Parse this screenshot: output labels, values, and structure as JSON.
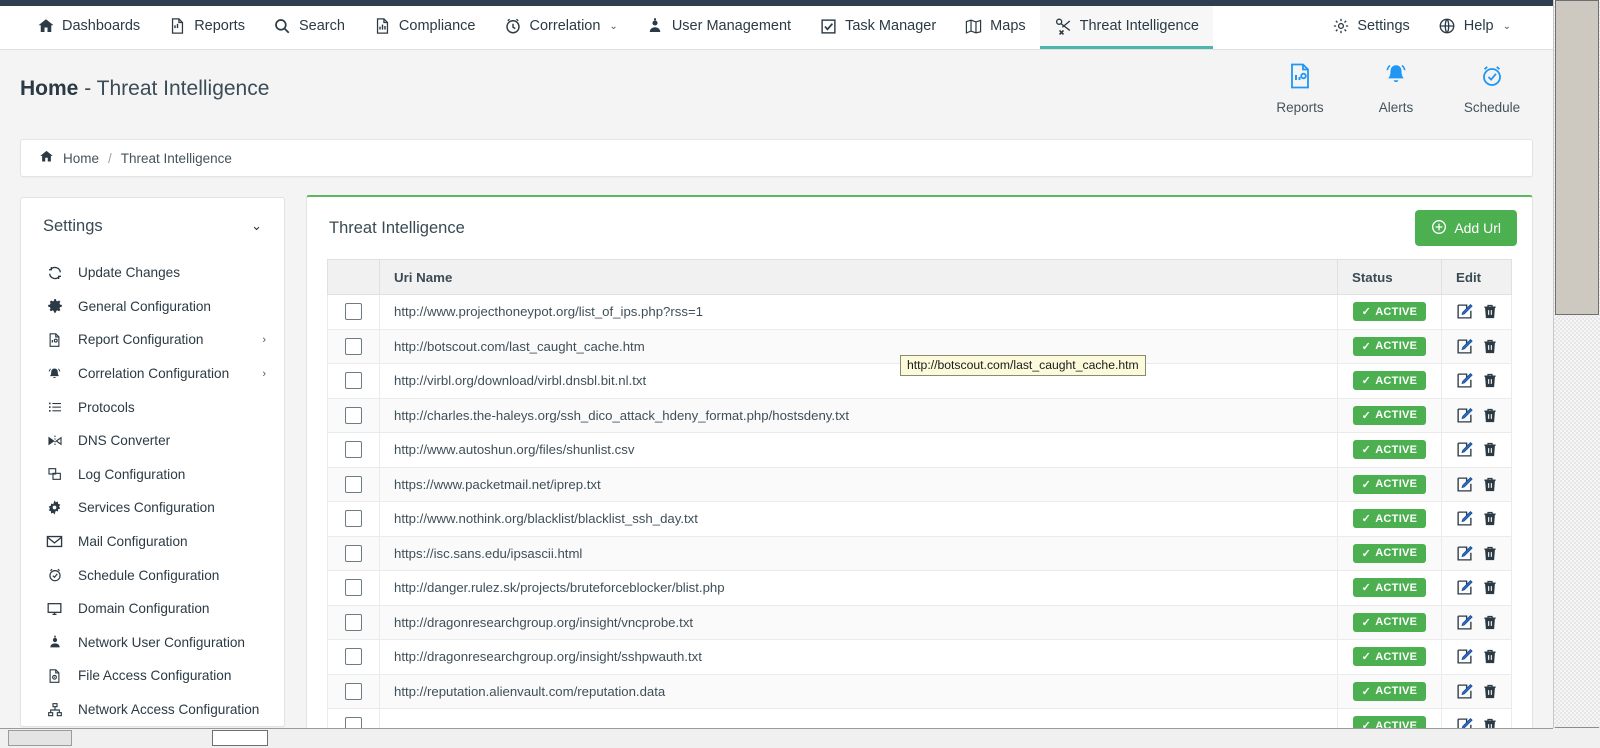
{
  "navbar": {
    "items": [
      {
        "label": "Dashboards",
        "icon": "home-icon",
        "active": false,
        "caret": false
      },
      {
        "label": "Reports",
        "icon": "report-document-icon",
        "active": false,
        "caret": false
      },
      {
        "label": "Search",
        "icon": "search-icon",
        "active": false,
        "caret": false
      },
      {
        "label": "Compliance",
        "icon": "bar-chart-document-icon",
        "active": false,
        "caret": false
      },
      {
        "label": "Correlation",
        "icon": "alarm-clock-icon",
        "active": false,
        "caret": true
      },
      {
        "label": "User Management",
        "icon": "user-icon",
        "active": false,
        "caret": false
      },
      {
        "label": "Task Manager",
        "icon": "checked-box-icon",
        "active": false,
        "caret": false
      },
      {
        "label": "Maps",
        "icon": "map-icon",
        "active": false,
        "caret": false
      },
      {
        "label": "Threat Intelligence",
        "icon": "threat-scissors-icon",
        "active": true,
        "caret": false
      }
    ],
    "right_items": [
      {
        "label": "Settings",
        "icon": "gear-icon",
        "caret": false
      },
      {
        "label": "Help",
        "icon": "globe-help-icon",
        "caret": true
      }
    ],
    "caret_glyph": "⌄"
  },
  "header": {
    "title_bold": "Home",
    "title_rest": " - Threat Intelligence",
    "quick_actions": [
      {
        "label": "Reports",
        "icon": "report-document-icon",
        "color": "#2196f3"
      },
      {
        "label": "Alerts",
        "icon": "bell-icon",
        "color": "#2196f3"
      },
      {
        "label": "Schedule",
        "icon": "alarm-clock-icon",
        "color": "#2196f3"
      }
    ]
  },
  "breadcrumb": {
    "home_icon": "home-icon",
    "home": "Home",
    "separator": "/",
    "current": "Threat Intelligence"
  },
  "sidebar": {
    "title": "Settings",
    "chevron": "⌄",
    "arrow_glyph": "›",
    "items": [
      {
        "label": "Update Changes",
        "icon": "refresh-icon",
        "arrow": false
      },
      {
        "label": "General Configuration",
        "icon": "gear-icon",
        "arrow": false
      },
      {
        "label": "Report Configuration",
        "icon": "report-document-icon",
        "arrow": true
      },
      {
        "label": "Correlation Configuration",
        "icon": "bell-icon",
        "arrow": true
      },
      {
        "label": "Protocols",
        "icon": "list-icon",
        "arrow": false
      },
      {
        "label": "DNS Converter",
        "icon": "dns-converter-icon",
        "arrow": false
      },
      {
        "label": "Log Configuration",
        "icon": "log-windows-icon",
        "arrow": false
      },
      {
        "label": "Services Configuration",
        "icon": "services-gear-icon",
        "arrow": false
      },
      {
        "label": "Mail Configuration",
        "icon": "envelope-icon",
        "arrow": false
      },
      {
        "label": "Schedule Configuration",
        "icon": "alarm-clock-icon",
        "arrow": false
      },
      {
        "label": "Domain Configuration",
        "icon": "monitor-icon",
        "arrow": false
      },
      {
        "label": "Network User Configuration",
        "icon": "user-icon",
        "arrow": false
      },
      {
        "label": "File Access Configuration",
        "icon": "file-search-icon",
        "arrow": false
      },
      {
        "label": "Network Access Configuration",
        "icon": "network-tree-icon",
        "arrow": false
      }
    ]
  },
  "panel": {
    "title": "Threat Intelligence",
    "add_button": {
      "label": "Add Url",
      "icon": "plus-circle-icon",
      "color": "#4caf50"
    },
    "table": {
      "columns": [
        "",
        "Uri Name",
        "Status",
        "Edit"
      ],
      "status_badge_label": "ACTIVE",
      "status_badge_check": "✓",
      "rows": [
        {
          "uri": "http://www.projecthoneypot.org/list_of_ips.php?rss=1",
          "status": "ACTIVE"
        },
        {
          "uri": "http://botscout.com/last_caught_cache.htm",
          "status": "ACTIVE"
        },
        {
          "uri": "http://virbl.org/download/virbl.dnsbl.bit.nl.txt",
          "status": "ACTIVE"
        },
        {
          "uri": "http://charles.the-haleys.org/ssh_dico_attack_hdeny_format.php/hostsdeny.txt",
          "status": "ACTIVE"
        },
        {
          "uri": "http://www.autoshun.org/files/shunlist.csv",
          "status": "ACTIVE"
        },
        {
          "uri": "https://www.packetmail.net/iprep.txt",
          "status": "ACTIVE"
        },
        {
          "uri": "http://www.nothink.org/blacklist/blacklist_ssh_day.txt",
          "status": "ACTIVE"
        },
        {
          "uri": "https://isc.sans.edu/ipsascii.html",
          "status": "ACTIVE"
        },
        {
          "uri": "http://danger.rulez.sk/projects/bruteforceblocker/blist.php",
          "status": "ACTIVE"
        },
        {
          "uri": "http://dragonresearchgroup.org/insight/vncprobe.txt",
          "status": "ACTIVE"
        },
        {
          "uri": "http://dragonresearchgroup.org/insight/sshpwauth.txt",
          "status": "ACTIVE"
        },
        {
          "uri": "http://reputation.alienvault.com/reputation.data",
          "status": "ACTIVE"
        },
        {
          "uri": "",
          "status": "ACTIVE"
        }
      ]
    }
  },
  "tooltip": {
    "text": "http://botscout.com/last_caught_cache.htm"
  }
}
